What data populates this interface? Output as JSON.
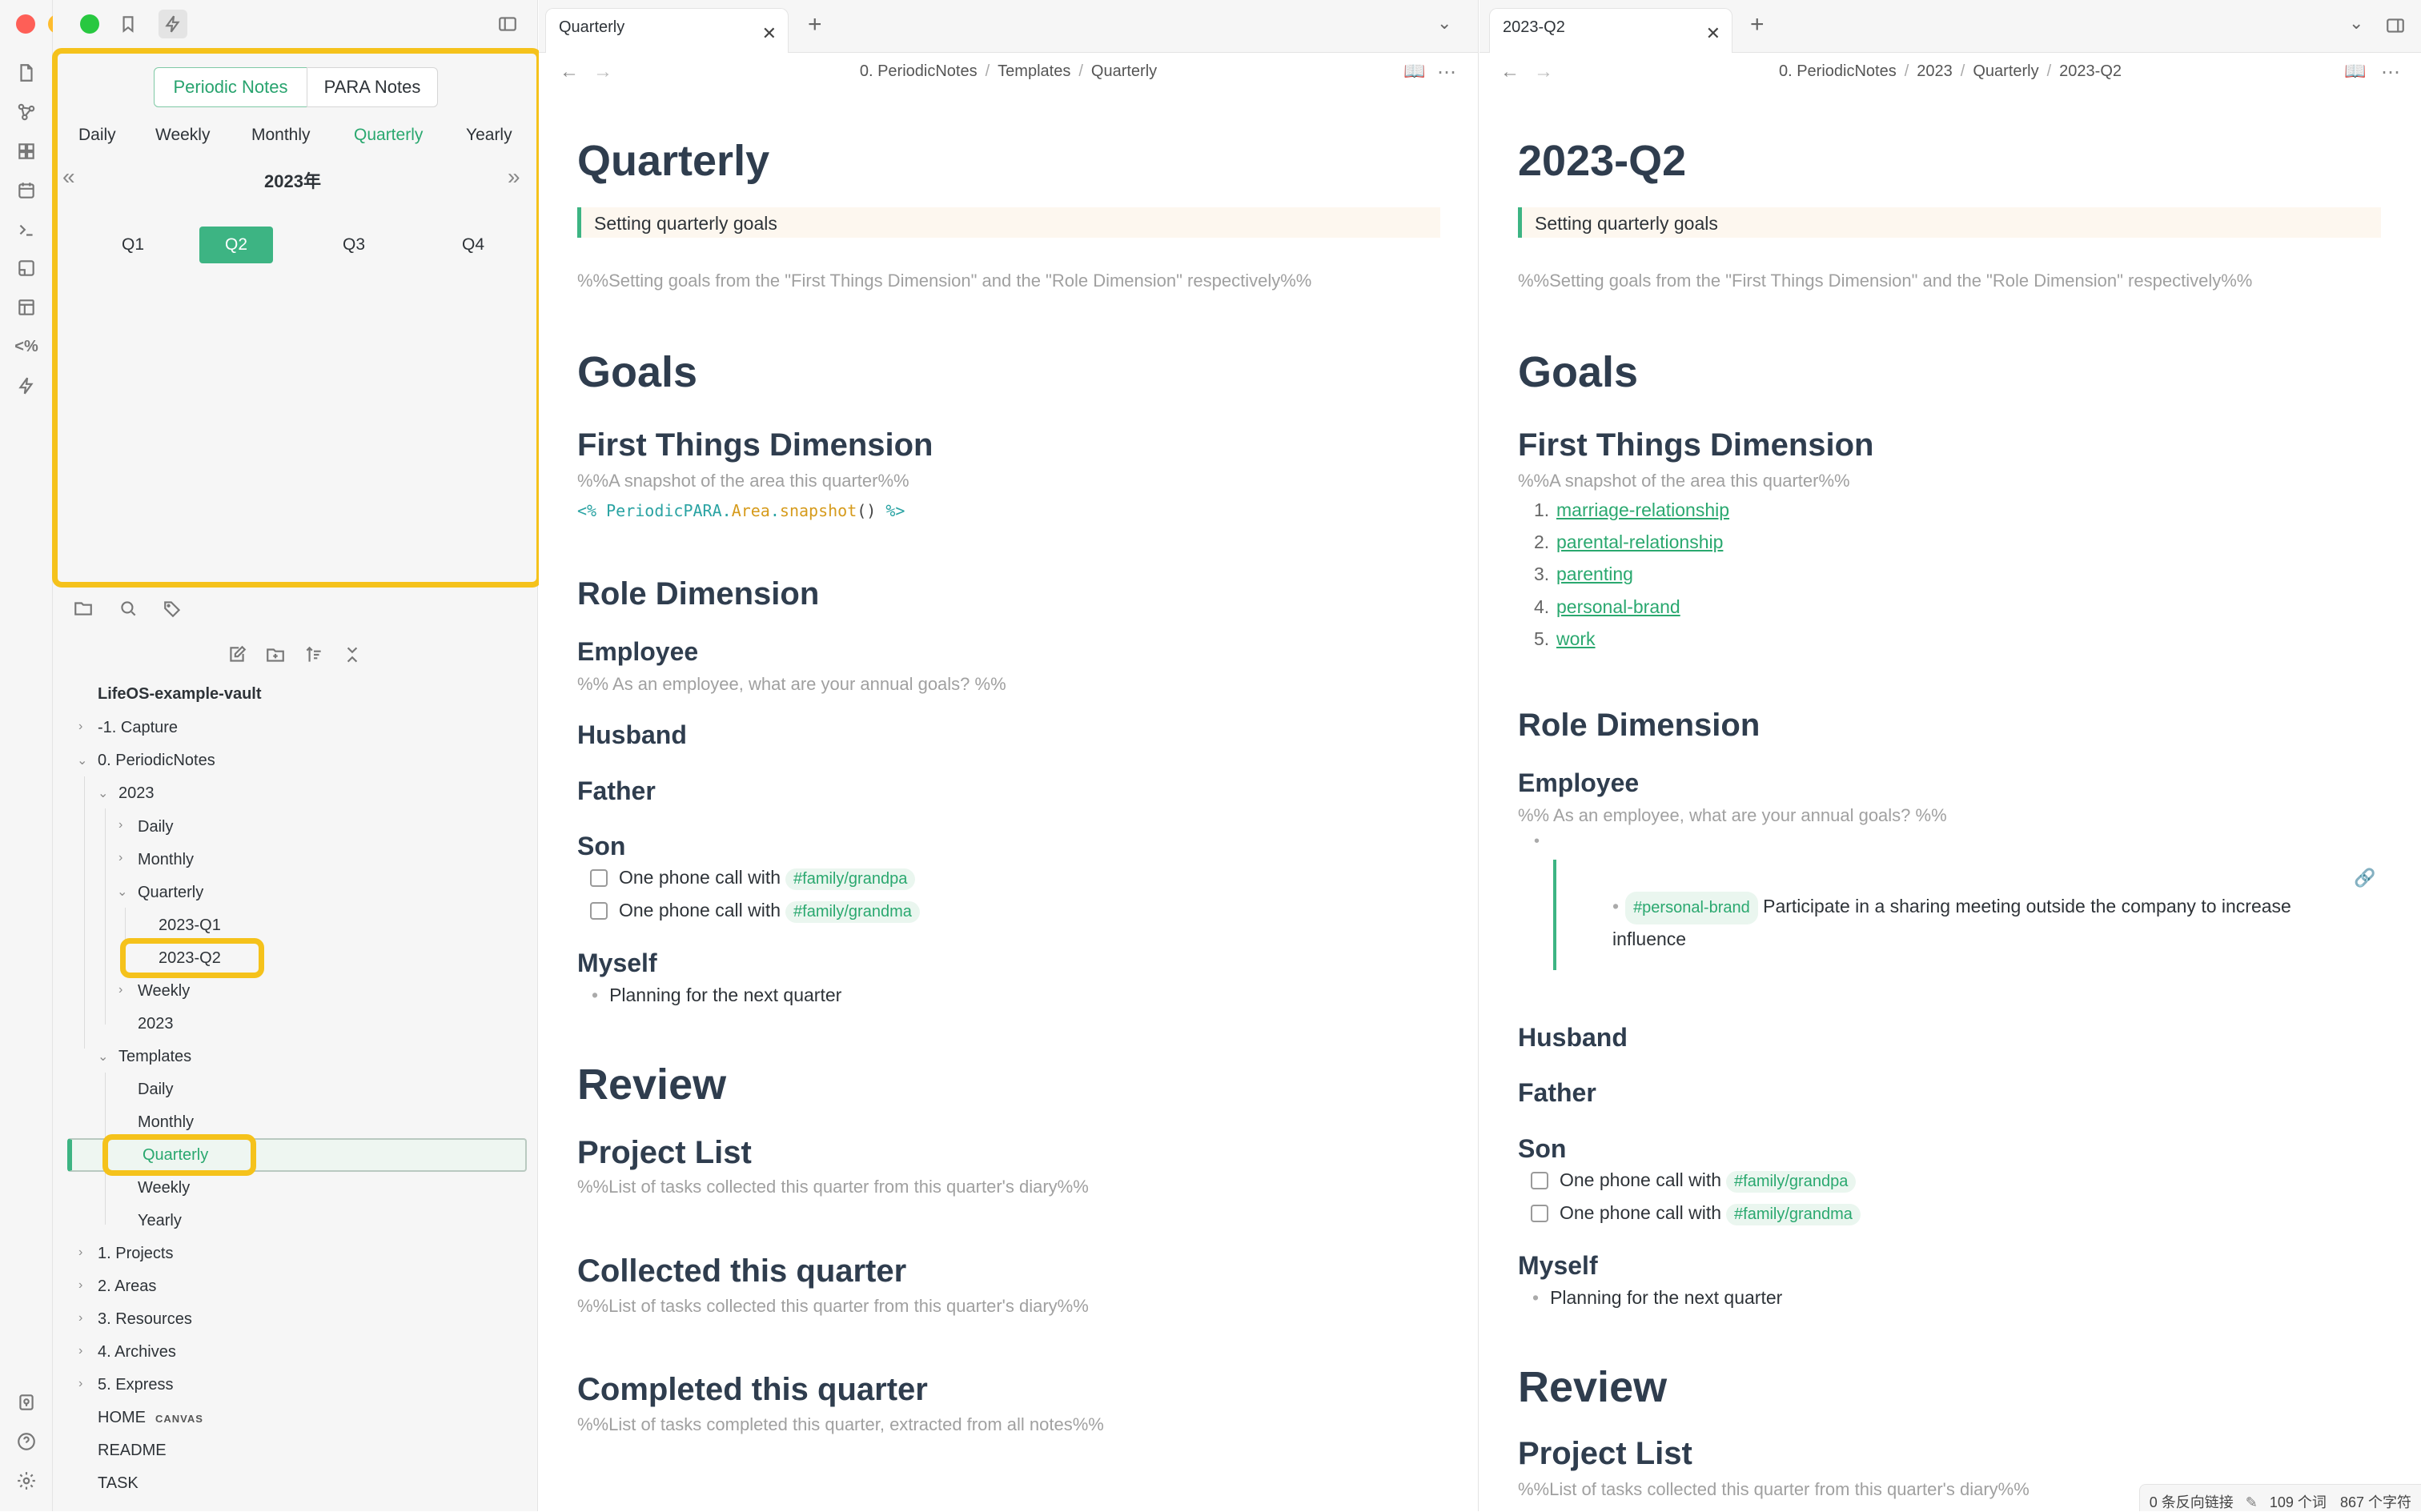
{
  "window": {
    "traffic_colors": [
      "#fe5f57",
      "#febc2e",
      "#28c840"
    ]
  },
  "ribbon": {
    "icons": [
      "files-icon",
      "graph-icon",
      "dashboard-icon",
      "calendar-icon",
      "terminal-icon",
      "canvas-icon",
      "template-icon",
      "templater-icon",
      "lightning-icon",
      "vault-icon",
      "help-icon",
      "settings-icon"
    ],
    "templater_label": "<%"
  },
  "periodic": {
    "segments": [
      "Periodic Notes",
      "PARA Notes"
    ],
    "periods": [
      "Daily",
      "Weekly",
      "Monthly",
      "Quarterly",
      "Yearly"
    ],
    "active_period": "Quarterly",
    "year": "2023年",
    "prev": "«",
    "next": "»",
    "quarters": [
      "Q1",
      "Q2",
      "Q3",
      "Q4"
    ],
    "active_quarter": "Q2"
  },
  "tree": {
    "vault": "LifeOS-example-vault",
    "capture": "-1. Capture",
    "periodic": "0. PeriodicNotes",
    "y2023": "2023",
    "daily": "Daily",
    "monthly": "Monthly",
    "quarterly": "Quarterly",
    "q1": "2023-Q1",
    "q2": "2023-Q2",
    "weekly": "Weekly",
    "y2023note": "2023",
    "templates": "Templates",
    "t_daily": "Daily",
    "t_monthly": "Monthly",
    "t_quarterly": "Quarterly",
    "t_weekly": "Weekly",
    "t_yearly": "Yearly",
    "projects": "1. Projects",
    "areas": "2. Areas",
    "resources": "3. Resources",
    "archives": "4. Archives",
    "express": "5. Express",
    "home": "HOME",
    "canvas": "CANVAS",
    "readme": "README",
    "task": "TASK"
  },
  "left_pane": {
    "tab_title": "Quarterly",
    "breadcrumb": [
      "0. PeriodicNotes",
      "Templates",
      "Quarterly"
    ],
    "title": "Quarterly",
    "callout": "Setting quarterly goals",
    "goals_comment": "%%Setting goals from the \"First Things Dimension\" and the \"Role Dimension\" respectively%%",
    "goals": "Goals",
    "first_things": "First Things Dimension",
    "snapshot_comment": "%%A snapshot of the area this quarter%%",
    "code_open": "<%",
    "code_obj": "PeriodicPARA",
    "code_prop": "Area",
    "code_fn": "snapshot",
    "code_args": "()",
    "code_close": "%>",
    "role": "Role Dimension",
    "employee": "Employee",
    "employee_comment": "%% As an employee, what are your annual goals? %%",
    "husband": "Husband",
    "father": "Father",
    "son": "Son",
    "task1": "One phone call with",
    "tag1": "#family/grandpa",
    "task2": "One phone call with",
    "tag2": "#family/grandma",
    "myself": "Myself",
    "plan": "Planning for the next quarter",
    "review": "Review",
    "project_list": "Project List",
    "project_comment": "%%List of tasks collected this quarter from this quarter's diary%%",
    "collected": "Collected this quarter",
    "collected_comment": "%%List of tasks collected this quarter from this quarter's diary%%",
    "completed": "Completed this quarter",
    "completed_comment": "%%List of tasks completed this quarter, extracted from all notes%%"
  },
  "right_pane": {
    "tab_title": "2023-Q2",
    "breadcrumb": [
      "0. PeriodicNotes",
      "2023",
      "Quarterly",
      "2023-Q2"
    ],
    "title": "2023-Q2",
    "callout": "Setting quarterly goals",
    "goals_comment": "%%Setting goals from the \"First Things Dimension\" and the \"Role Dimension\" respectively%%",
    "goals": "Goals",
    "first_things": "First Things Dimension",
    "snapshot_comment": "%%A snapshot of the area this quarter%%",
    "areas": [
      "marriage-relationship",
      "parental-relationship",
      "parenting",
      "personal-brand",
      "work"
    ],
    "role": "Role Dimension",
    "employee": "Employee",
    "employee_comment": "%% As an employee, what are your annual goals? %%",
    "embed_tag": "#personal-brand",
    "embed_text_1": "Participate in a sharing meeting outside the company to increase",
    "embed_text_2": "influence",
    "husband": "Husband",
    "father": "Father",
    "son": "Son",
    "task1": "One phone call with",
    "tag1": "#family/grandpa",
    "task2": "One phone call with",
    "tag2": "#family/grandma",
    "myself": "Myself",
    "plan": "Planning for the next quarter",
    "review": "Review",
    "project_list": "Project List",
    "project_comment": "%%List of tasks collected this quarter from this quarter's diary%%"
  },
  "status": {
    "backlinks": "0 条反向链接",
    "words": "109 个词",
    "chars": "867 个字符"
  },
  "highlight_color": "#f5c21b",
  "accent_color": "#2aa86f"
}
